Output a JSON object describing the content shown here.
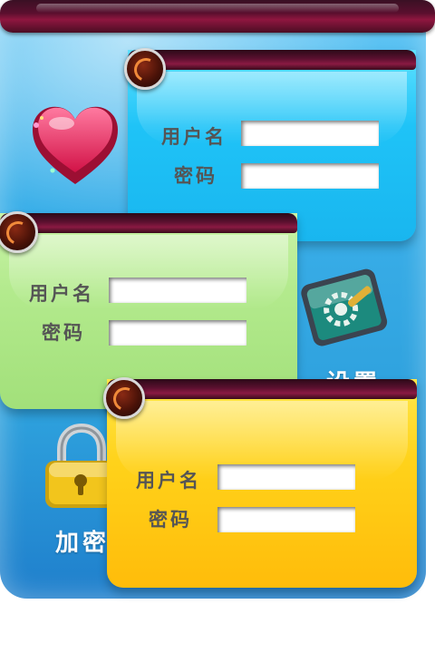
{
  "nav": {
    "items": [
      {
        "label": "加密"
      }
    ],
    "partial_labels": [
      "设置"
    ]
  },
  "cards": {
    "blue": {
      "username_label": "用户名",
      "password_label": "密码",
      "username_value": "",
      "password_value": ""
    },
    "green": {
      "username_label": "用户名",
      "password_label": "密码",
      "username_value": "",
      "password_value": ""
    },
    "yellow": {
      "username_label": "用户名",
      "password_label": "密码",
      "username_value": "",
      "password_value": ""
    }
  },
  "colors": {
    "background": "#39aee8",
    "top_bar": "#5a0f2e",
    "card_blue": "#1fc3f7",
    "card_green": "#b3ea8d",
    "card_yellow": "#ffd21a"
  },
  "icons": [
    "heart-box-icon",
    "settings-tool-icon",
    "padlock-icon",
    "power-knob-icon"
  ]
}
